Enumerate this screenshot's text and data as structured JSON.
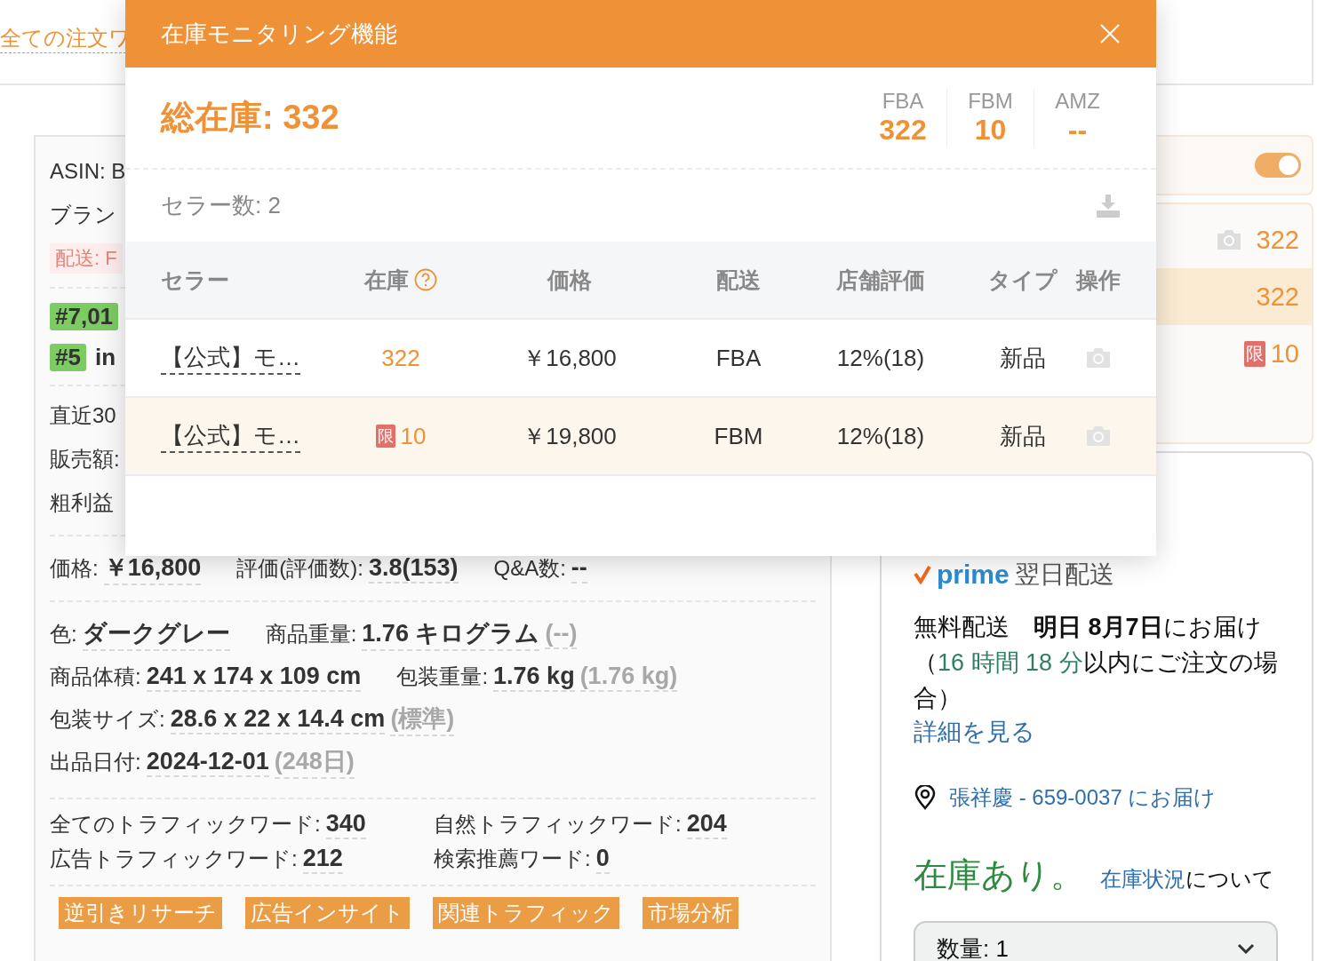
{
  "top_bar": {
    "link": "全ての注文ワ"
  },
  "left_card": {
    "asin": "ASIN: B",
    "brand": "ブラン",
    "shipping_tag": "配送: F",
    "ranks": [
      {
        "rank": "#7,01"
      },
      {
        "rank": "#5",
        "text": "in"
      }
    ],
    "metrics": [
      "直近30",
      "販売額:",
      "粗利益"
    ],
    "summary": [
      {
        "label": "価格:",
        "value": "￥16,800"
      },
      {
        "label": "評価(評価数):",
        "value": "3.8(153)"
      },
      {
        "label": "Q&A数:",
        "value": "--"
      }
    ],
    "attributes": [
      [
        {
          "label": "色:",
          "value": "ダークグレー"
        },
        {
          "label": "商品重量:",
          "value": "1.76 キログラム",
          "note": "(--)"
        }
      ],
      [
        {
          "label": "商品体積:",
          "value": "241 x 174 x 109 cm"
        },
        {
          "label": "包装重量:",
          "value": "1.76 kg",
          "note": "(1.76 kg)"
        }
      ],
      [
        {
          "label": "包装サイズ:",
          "value": "28.6 x 22 x 14.4 cm",
          "note": "(標準)"
        }
      ],
      [
        {
          "label": "出品日付:",
          "value": "2024-12-01",
          "note": "(248日)"
        }
      ]
    ],
    "traffic": [
      {
        "label": "全てのトラフィックワード:",
        "value": "340"
      },
      {
        "label": "自然トラフィックワード:",
        "value": "204"
      },
      {
        "label": "広告トラフィックワード:",
        "value": "212"
      },
      {
        "label": "検索推薦ワード:",
        "value": "0"
      }
    ],
    "tools": [
      "逆引きリサーチ",
      "広告インサイト",
      "関連トラフィック",
      "市場分析"
    ]
  },
  "right_panel": {
    "toggle": {
      "on": true
    },
    "rows": [
      {
        "value": "322",
        "camera": true,
        "selected": false
      },
      {
        "value": "322",
        "camera": false,
        "selected": true
      },
      {
        "limit_badge": "限",
        "value": "10",
        "camera": false,
        "selected": false
      }
    ]
  },
  "offer_card": {
    "prime_logo": "prime",
    "prime_label": "翌日配送",
    "delivery": [
      {
        "text": "無料配送　",
        "kind": "normal"
      },
      {
        "text": "明日 8月7日",
        "kind": "bold"
      },
      {
        "text": "にお届け（",
        "kind": "normal"
      },
      {
        "text": "16 時間 18 分",
        "kind": "green"
      },
      {
        "text": "以内にご注文の場合）",
        "kind": "normal"
      }
    ],
    "details_link": "詳細を見る",
    "address": "張祥慶 - 659-0037 にお届け",
    "stock_status": "在庫あり。",
    "stock_link": "在庫状況",
    "stock_suffix": "について",
    "quantity": "数量:  1"
  },
  "modal": {
    "title": "在庫モニタリング機能",
    "total": "総在庫: 332",
    "breakdown": [
      {
        "label": "FBA",
        "value": "322"
      },
      {
        "label": "FBM",
        "value": "10"
      },
      {
        "label": "AMZ",
        "value": "--"
      }
    ],
    "seller_count": "セラー数: 2",
    "columns": [
      "セラー",
      "在庫",
      "価格",
      "配送",
      "店舗評価",
      "タイプ",
      "操作"
    ],
    "rows": [
      {
        "seller": "【公式】モ…",
        "stock": "322",
        "price": "￥16,800",
        "shipping": "FBA",
        "rating": "12%(18)",
        "type": "新品",
        "selected": false
      },
      {
        "seller": "【公式】モ…",
        "limit_badge": "限",
        "stock": "10",
        "price": "￥19,800",
        "shipping": "FBM",
        "rating": "12%(18)",
        "type": "新品",
        "selected": true
      }
    ]
  }
}
